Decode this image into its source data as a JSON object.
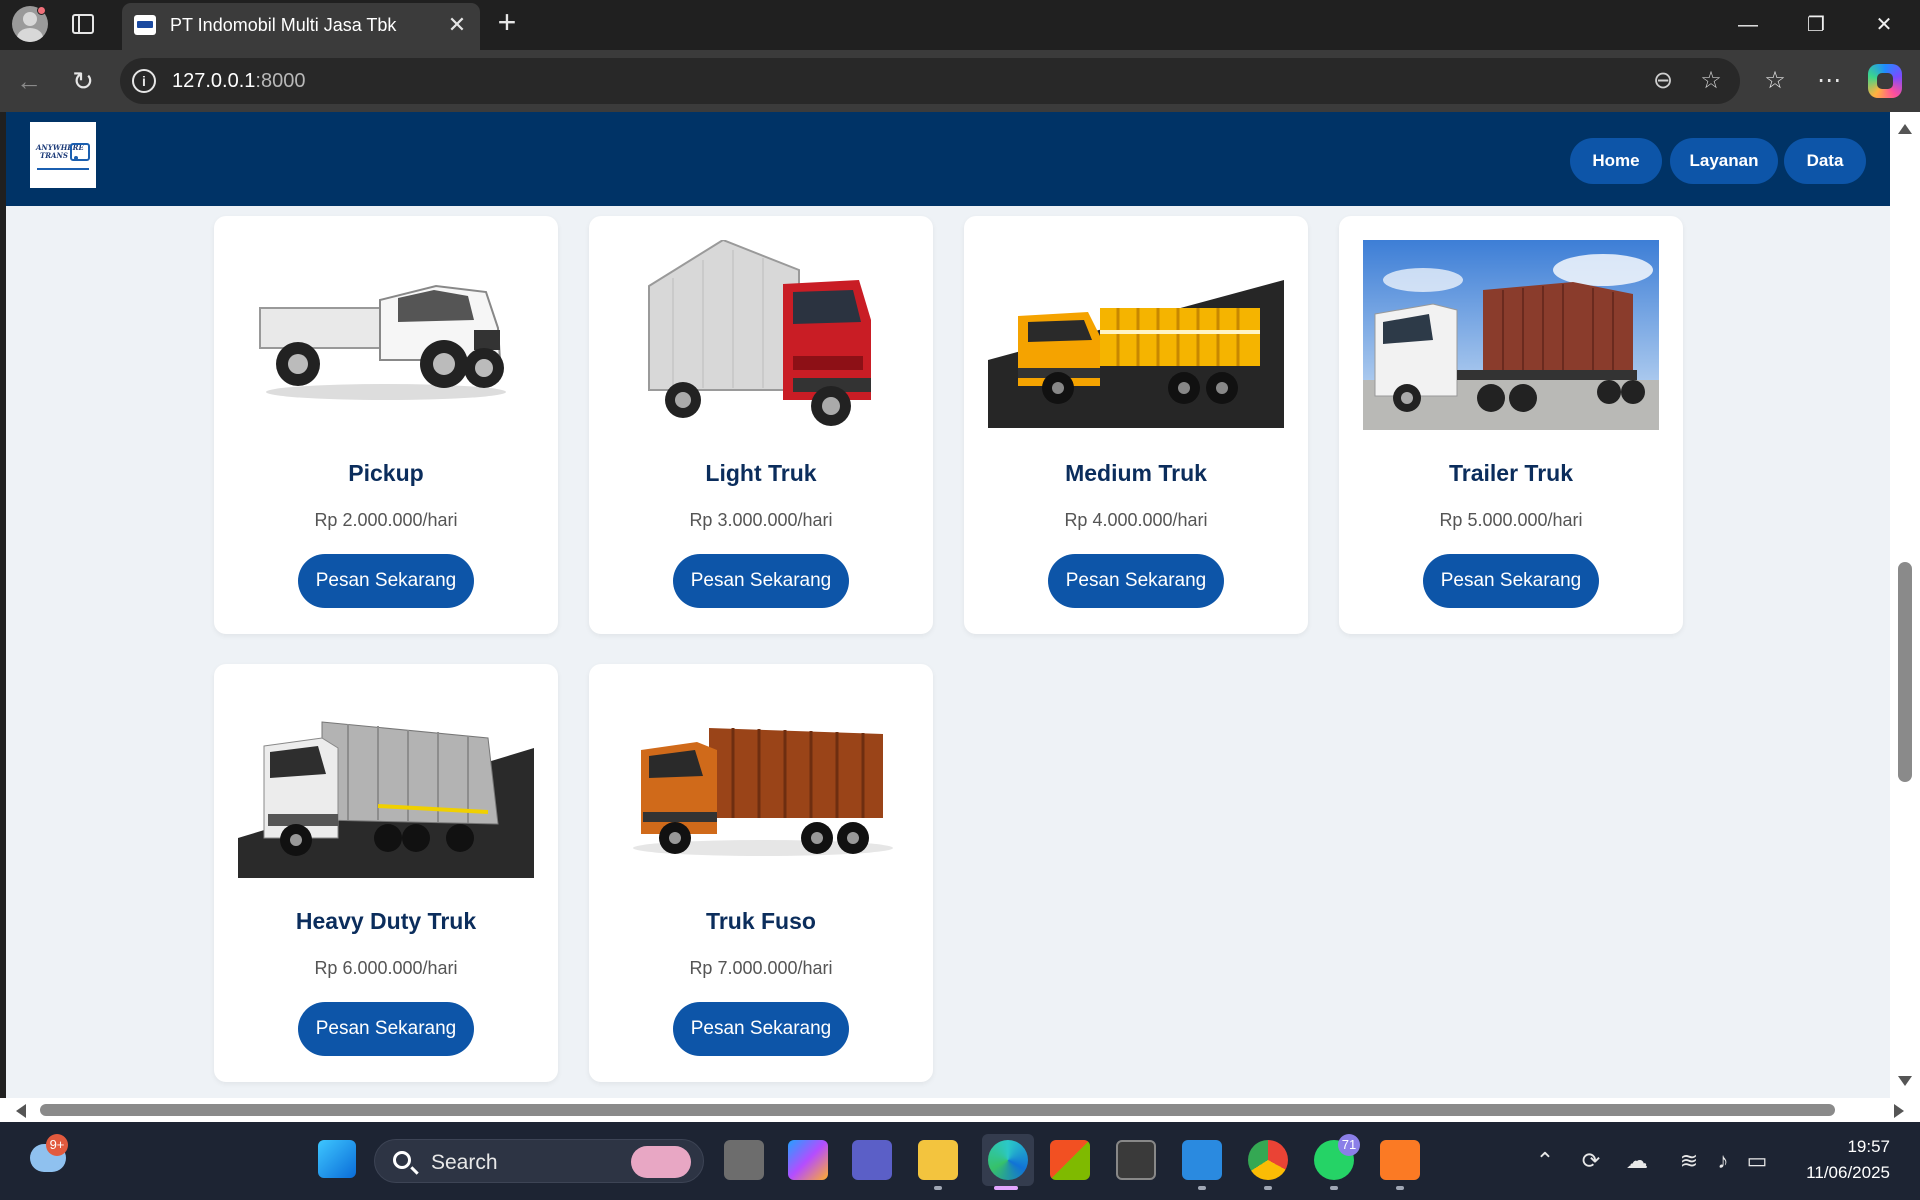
{
  "browser": {
    "tab_title": "PT Indomobil Multi Jasa Tbk",
    "url_host": "127.0.0.1",
    "url_port": ":8000"
  },
  "site": {
    "logo_text": "ANYWHERE TRANS",
    "nav": [
      {
        "label": "Home"
      },
      {
        "label": "Layanan"
      },
      {
        "label": "Data"
      }
    ]
  },
  "vehicles": [
    {
      "name": "Pickup",
      "price": "Rp 2.000.000/hari",
      "button": "Pesan Sekarang",
      "body_color": "#f4f4f4"
    },
    {
      "name": "Light Truk",
      "price": "Rp 3.000.000/hari",
      "button": "Pesan Sekarang",
      "body_color": "#c91d25"
    },
    {
      "name": "Medium Truk",
      "price": "Rp 4.000.000/hari",
      "button": "Pesan Sekarang",
      "body_color": "#f5a300"
    },
    {
      "name": "Trailer Truk",
      "price": "Rp 5.000.000/hari",
      "button": "Pesan Sekarang",
      "body_color": "#8a3c2c"
    },
    {
      "name": "Heavy Duty Truk",
      "price": "Rp 6.000.000/hari",
      "button": "Pesan Sekarang",
      "body_color": "#e8e8e8"
    },
    {
      "name": "Truk Fuso",
      "price": "Rp 7.000.000/hari",
      "button": "Pesan Sekarang",
      "body_color": "#d06a1a"
    }
  ],
  "taskbar": {
    "search_label": "Search",
    "weather_badge": "9+",
    "whatsapp_badge": "71",
    "time": "19:57",
    "date": "11/06/2025"
  },
  "colors": {
    "header_bg": "#003366",
    "button_bg": "#0d55a8",
    "title_color": "#0b2d5c",
    "page_bg": "#eef2f6"
  }
}
